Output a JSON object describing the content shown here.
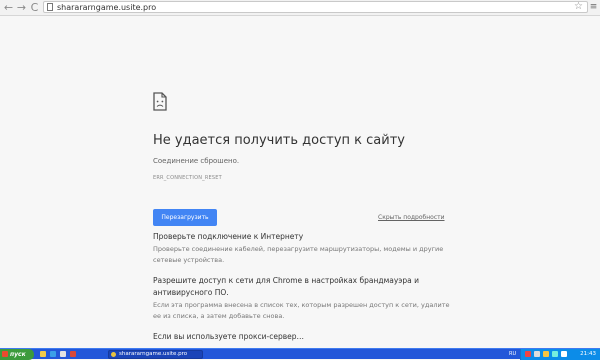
{
  "browser": {
    "url": "sharararngame.usite.pro",
    "back_glyph": "←",
    "forward_glyph": "→",
    "reload_glyph": "C",
    "star_glyph": "☆",
    "menu_glyph": "≡"
  },
  "error": {
    "title": "Не удается получить доступ к сайту",
    "description": "Соединение сброшено.",
    "code": "ERR_CONNECTION_RESET",
    "reload_label": "Перезагрузить",
    "details_label": "Скрыть подробности"
  },
  "suggestions": [
    {
      "heading": "Проверьте подключение к Интернету",
      "body": "Проверьте соединение кабелей, перезагрузите маршрутизаторы, модемы и другие сетевые устройства."
    },
    {
      "heading": "Разрешите доступ к сети для Chrome в настройках брандмауэра и антивирусного ПО.",
      "body": "Если эта программа внесена в список тех, которым разрешен доступ к сети, удалите ее из списка, а затем добавьте снова."
    },
    {
      "heading": "Если вы используете прокси-сервер…",
      "body": ""
    }
  ],
  "taskbar": {
    "start_label": "пуск",
    "task_label": "sharararngame.usite.pro",
    "language": "RU",
    "clock": "21:43"
  },
  "colors": {
    "accent": "#4285f4",
    "taskbar": "#2357d9",
    "start": "#3c9b3c",
    "tray": "#0c8ce8"
  }
}
